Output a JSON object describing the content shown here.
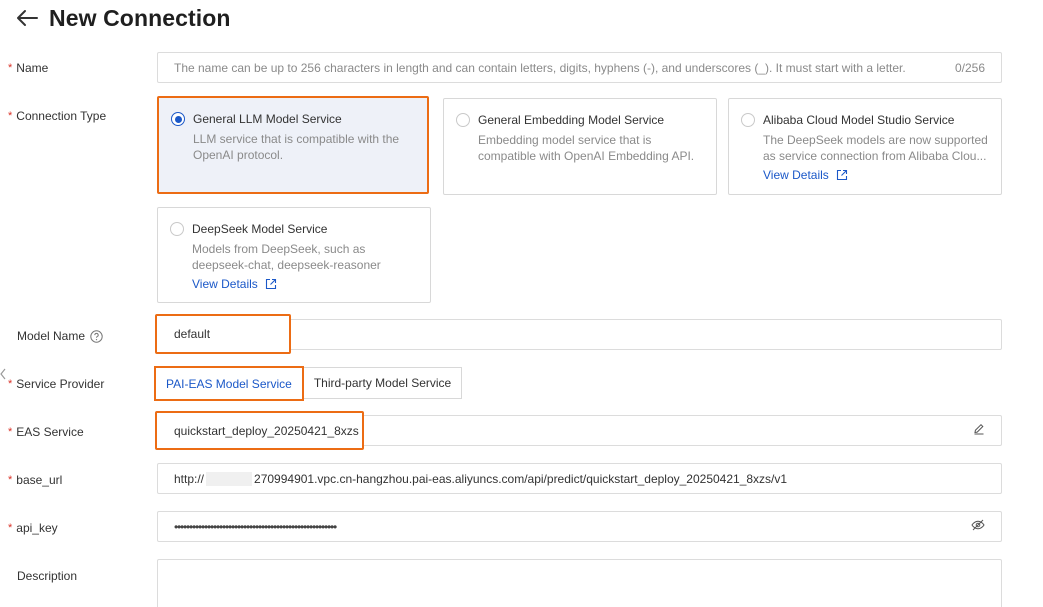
{
  "header": {
    "title": "New Connection"
  },
  "form": {
    "name": {
      "label": "Name",
      "placeholder": "The name can be up to 256 characters in length and can contain letters, digits, hyphens (-), and underscores (_). It must start with a letter.",
      "counter": "0/256"
    },
    "connection_type": {
      "label": "Connection Type",
      "options": [
        {
          "title": "General LLM Model Service",
          "desc_line1": "LLM service that is compatible with the",
          "desc_line2": "OpenAI protocol."
        },
        {
          "title": "General Embedding Model Service",
          "desc_line1": "Embedding model service that is",
          "desc_line2": "compatible with OpenAI Embedding API."
        },
        {
          "title": "Alibaba Cloud Model Studio Service",
          "desc_line1": "The DeepSeek models are now supported",
          "desc_line2": "as service connection from Alibaba Clou...",
          "link": "View Details"
        },
        {
          "title": "DeepSeek Model Service",
          "desc_line1": "Models from DeepSeek, such as",
          "desc_line2": "deepseek-chat, deepseek-reasoner",
          "link": "View Details"
        }
      ]
    },
    "model_name": {
      "label": "Model Name",
      "value": "default"
    },
    "service_provider": {
      "label": "Service Provider",
      "options": [
        "PAI-EAS Model Service",
        "Third-party Model Service"
      ]
    },
    "eas_service": {
      "label": "EAS Service",
      "value": "quickstart_deploy_20250421_8xzs"
    },
    "base_url": {
      "label": "base_url",
      "prefix": "http://",
      "suffix": "270994901.vpc.cn-hangzhou.pai-eas.aliyuncs.com/api/predict/quickstart_deploy_20250421_8xzs/v1"
    },
    "api_key": {
      "label": "api_key",
      "value": "••••••••••••••••••••••••••••••••••••••••••••••••••••••"
    },
    "description": {
      "label": "Description"
    }
  },
  "colors": {
    "accent": "#1b58c8",
    "highlight": "#ec6c14",
    "required": "#d93026"
  }
}
